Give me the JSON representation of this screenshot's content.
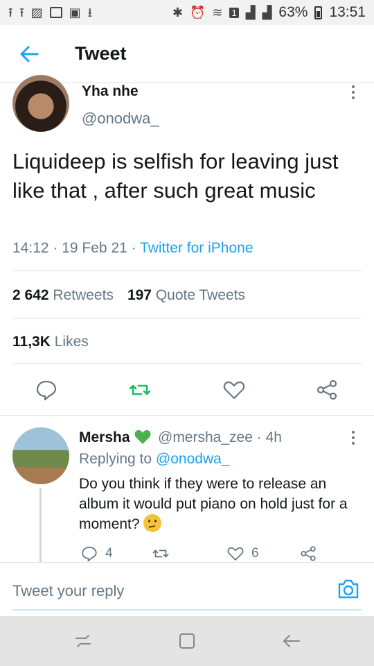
{
  "status_bar": {
    "battery": "63%",
    "time": "13:51",
    "sim_badge": "1"
  },
  "header": {
    "title": "Tweet"
  },
  "tweet": {
    "author_name": "Yha nhe",
    "author_handle": "@onodwa_",
    "text": "Liquideep is selfish for leaving just like that , after such great music",
    "time": "14:12",
    "date": "19 Feb 21",
    "source": "Twitter for iPhone",
    "retweets_count": "2 642",
    "retweets_label": "Retweets",
    "quote_count": "197",
    "quote_label": "Quote Tweets",
    "likes_count": "11,3K",
    "likes_label": "Likes"
  },
  "reply": {
    "author_name": "Mersha",
    "author_handle": "@mersha_zee",
    "age": "4h",
    "replying_prefix": "Replying to",
    "replying_to": "@onodwa_",
    "text": "Do you think if they were to release an album it would put piano on hold just for a moment?",
    "reply_count": "4",
    "like_count": "6"
  },
  "compose": {
    "placeholder": "Tweet your reply"
  },
  "colors": {
    "accent": "#1da1f2",
    "retweet_green": "#17bf63",
    "heart_green": "#4caf50",
    "muted": "#657786"
  },
  "icons": [
    "back-arrow-icon",
    "more-vertical-icon",
    "reply-icon",
    "retweet-icon",
    "like-icon",
    "share-icon",
    "green-heart-icon",
    "thinking-emoji",
    "camera-icon",
    "nav-recent-icon",
    "nav-home-icon",
    "nav-back-icon"
  ]
}
